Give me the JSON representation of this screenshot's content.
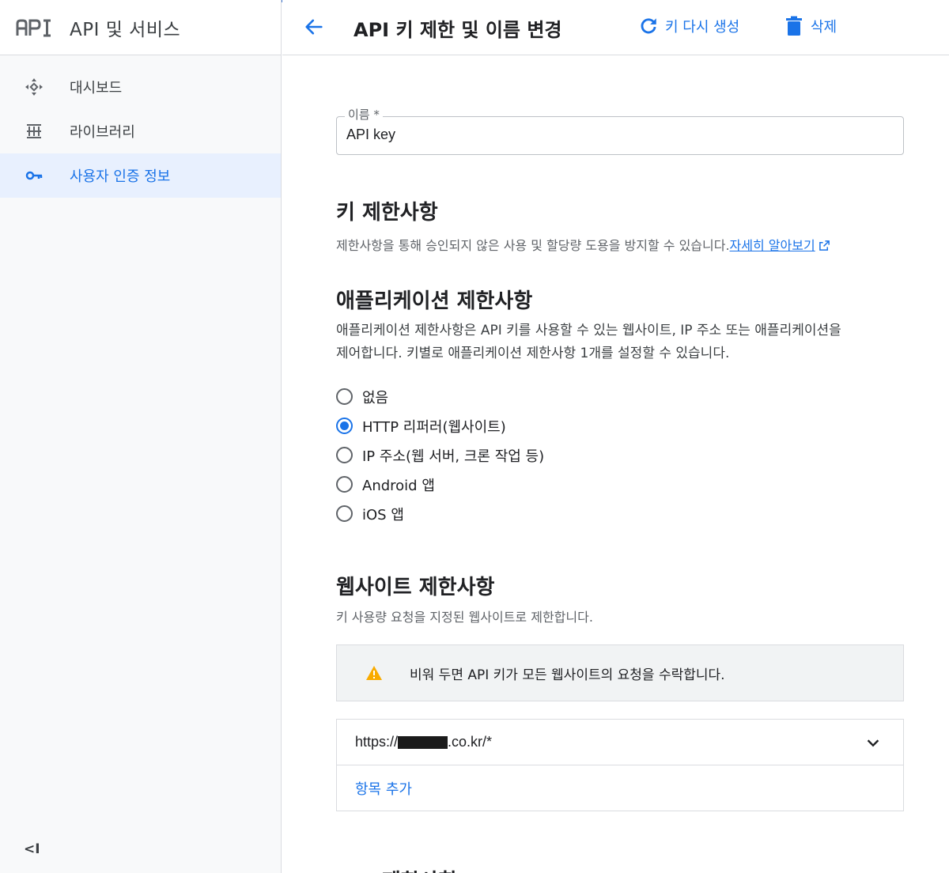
{
  "sidebar": {
    "logo_text": "API",
    "title": "API 및 서비스",
    "items": [
      {
        "label": "대시보드",
        "icon": "dashboard-icon",
        "active": false
      },
      {
        "label": "라이브러리",
        "icon": "library-icon",
        "active": false
      },
      {
        "label": "사용자 인증 정보",
        "icon": "key-icon",
        "active": true
      }
    ],
    "collapse_label": "<I"
  },
  "header": {
    "title": "API 키 제한 및 이름 변경",
    "regenerate_label": "키 다시 생성",
    "delete_label": "삭제"
  },
  "form": {
    "name_label": "이름 *",
    "name_value": "API key"
  },
  "key_restrictions": {
    "heading": "키 제한사항",
    "description": "제한사항을 통해 승인되지 않은 사용 및 할당량 도용을 방지할 수 있습니다.",
    "learn_more": "자세히 알아보기"
  },
  "app_restrictions": {
    "heading": "애플리케이션 제한사항",
    "description_line1": "애플리케이션 제한사항은 API 키를 사용할 수 있는 웹사이트, IP 주소 또는 애플리케이션을",
    "description_line2": "제어합니다. 키별로 애플리케이션 제한사항 1개를 설정할 수 있습니다.",
    "options": [
      {
        "label": "없음",
        "checked": false
      },
      {
        "label": "HTTP 리퍼러(웹사이트)",
        "checked": true
      },
      {
        "label": "IP 주소(웹 서버, 크론 작업 등)",
        "checked": false
      },
      {
        "label": "Android 앱",
        "checked": false
      },
      {
        "label": "iOS 앱",
        "checked": false
      }
    ]
  },
  "website_restrictions": {
    "heading": "웹사이트 제한사항",
    "description": "키 사용량 요청을 지정된 웹사이트로 제한합니다.",
    "warning": "비워 두면 API 키가 모든 웹사이트의 요청을 수락합니다.",
    "url_prefix": "https://",
    "url_suffix": ".co.kr/*",
    "add_item": "항목 추가"
  },
  "api_restrictions": {
    "heading": "API 제한사항"
  },
  "colors": {
    "accent": "#1a73e8",
    "warning": "#f9ab00",
    "active_bg": "#e8f0fe"
  }
}
